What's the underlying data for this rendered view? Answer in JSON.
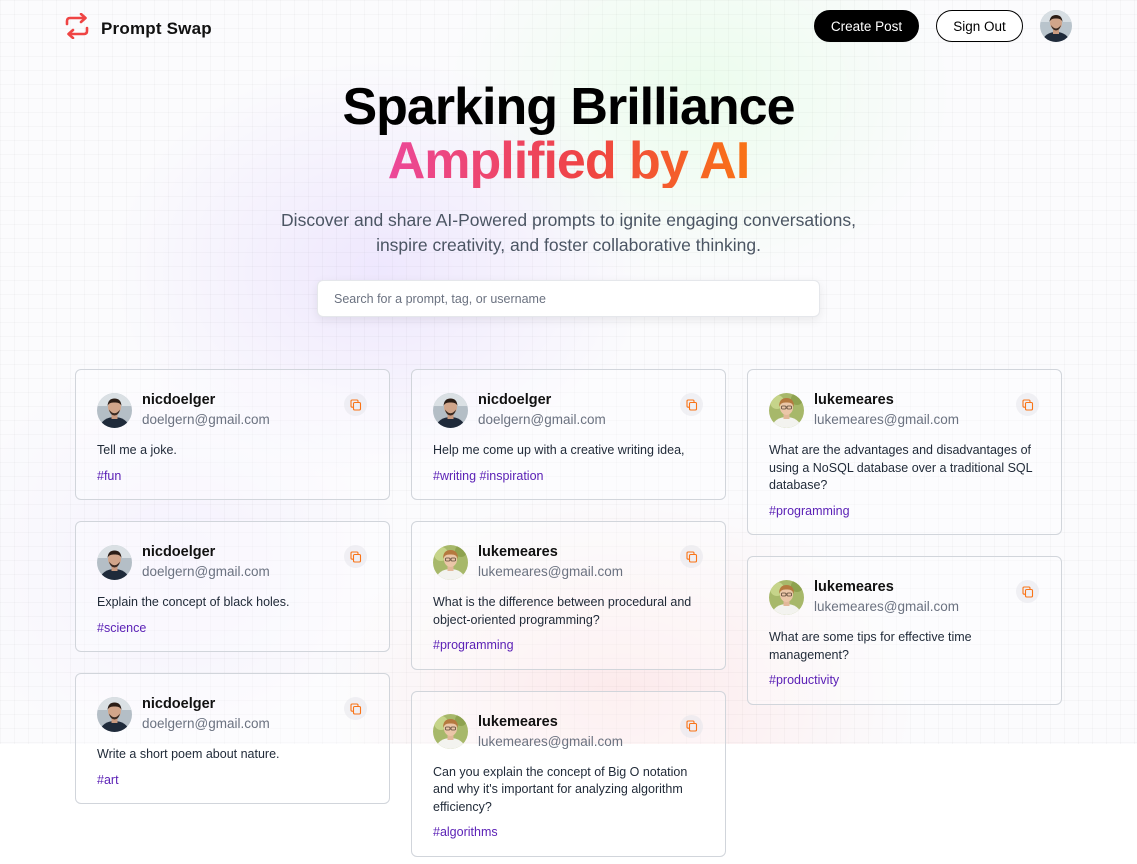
{
  "app": {
    "name": "Prompt Swap"
  },
  "nav": {
    "create_label": "Create Post",
    "signout_label": "Sign Out"
  },
  "hero": {
    "title_line1": "Sparking Brilliance",
    "title_line2": "Amplified by AI",
    "description": "Discover and share AI-Powered prompts to ignite engaging conversations, inspire creativity, and foster collaborative thinking."
  },
  "search": {
    "placeholder": "Search for a prompt, tag, or username",
    "value": ""
  },
  "columns": [
    [
      {
        "username": "nicdoelger",
        "email": "doelgern@gmail.com",
        "prompt": "Tell me a joke.",
        "tag": "#fun",
        "avatar": "nic"
      },
      {
        "username": "nicdoelger",
        "email": "doelgern@gmail.com",
        "prompt": "Explain the concept of black holes.",
        "tag": "#science",
        "avatar": "nic"
      },
      {
        "username": "nicdoelger",
        "email": "doelgern@gmail.com",
        "prompt": "Write a short poem about nature.",
        "tag": "#art",
        "avatar": "nic"
      }
    ],
    [
      {
        "username": "nicdoelger",
        "email": "doelgern@gmail.com",
        "prompt": "Help me come up with a creative writing idea,",
        "tag": "#writing #inspiration",
        "avatar": "nic"
      },
      {
        "username": "lukemeares",
        "email": "lukemeares@gmail.com",
        "prompt": "What is the difference between procedural and object-oriented programming?",
        "tag": "#programming",
        "avatar": "luke"
      },
      {
        "username": "lukemeares",
        "email": "lukemeares@gmail.com",
        "prompt": "Can you explain the concept of Big O notation and why it's important for analyzing algorithm efficiency?",
        "tag": "#algorithms",
        "avatar": "luke"
      }
    ],
    [
      {
        "username": "lukemeares",
        "email": "lukemeares@gmail.com",
        "prompt": "What are the advantages and disadvantages of using a NoSQL database over a traditional SQL database?",
        "tag": "#programming",
        "avatar": "luke"
      },
      {
        "username": "lukemeares",
        "email": "lukemeares@gmail.com",
        "prompt": "What are some tips for effective time management?",
        "tag": "#productivity",
        "avatar": "luke"
      }
    ]
  ],
  "icons": {
    "logo": "swap-arrows-icon",
    "copy": "copy-icon"
  },
  "colors": {
    "logo": "#ef4444",
    "tag": "#5b21b6",
    "copy_icon": "#f97316",
    "gradient": [
      "#ec4899",
      "#ef4444",
      "#f97316"
    ]
  }
}
